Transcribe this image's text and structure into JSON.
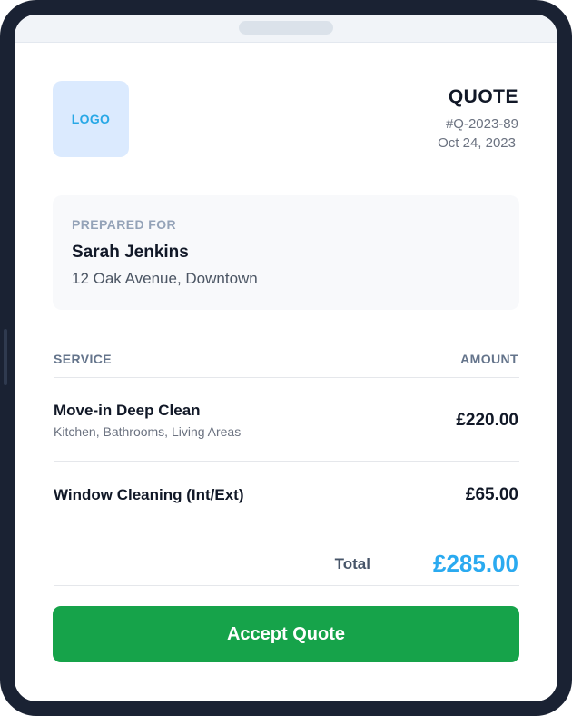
{
  "header": {
    "logo_text": "LOGO",
    "title": "QUOTE",
    "quote_number": "#Q-2023-89",
    "date": "Oct 24, 2023"
  },
  "prepared_for": {
    "label": "PREPARED FOR",
    "name": "Sarah Jenkins",
    "address": "12 Oak Avenue, Downtown"
  },
  "table": {
    "columns": [
      "SERVICE",
      "AMOUNT"
    ],
    "items": [
      {
        "title": "Move-in Deep Clean",
        "subtitle": "Kitchen, Bathrooms, Living Areas",
        "amount": "£220.00"
      },
      {
        "title": "Window Cleaning (Int/Ext)",
        "subtitle": "",
        "amount": "£65.00"
      }
    ]
  },
  "total": {
    "label": "Total",
    "value": "£285.00"
  },
  "actions": {
    "accept_label": "Accept Quote"
  },
  "colors": {
    "accent": "#2aaaf0",
    "primary_button": "#16a34a",
    "device_frame": "#1a2233"
  }
}
